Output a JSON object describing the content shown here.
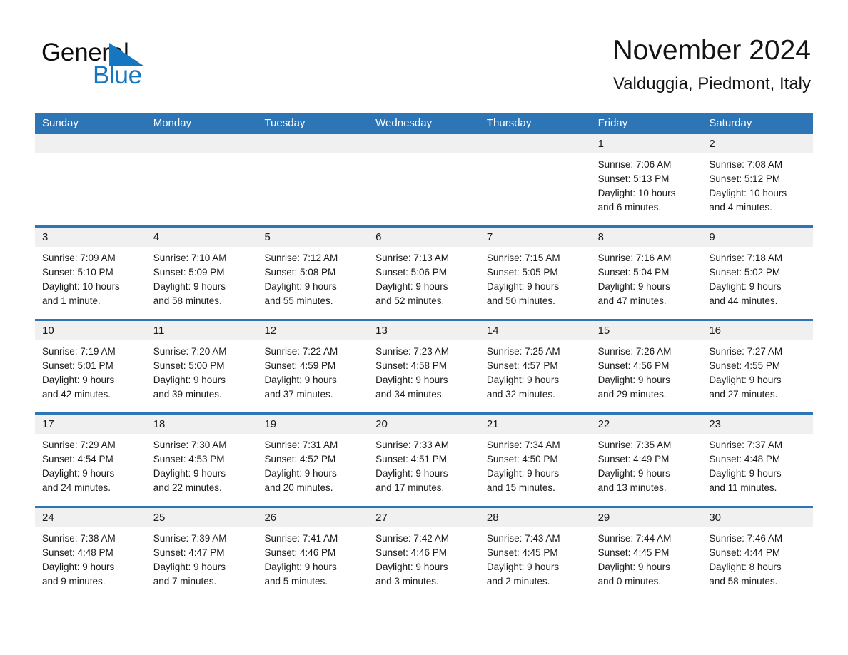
{
  "brand": {
    "line1": "General",
    "line2": "Blue",
    "triangle_color": "#1577c2",
    "icon": "triangle-logo-icon"
  },
  "header": {
    "title": "November 2024",
    "subtitle": "Valduggia, Piedmont, Italy"
  },
  "theme": {
    "header_blue": "#2e75b6",
    "day_band_gray": "#f0f0f0",
    "text": "#1a1a1a",
    "brand_blue": "#1577c2"
  },
  "weekdays": [
    "Sunday",
    "Monday",
    "Tuesday",
    "Wednesday",
    "Thursday",
    "Friday",
    "Saturday"
  ],
  "weeks": [
    [
      {
        "day": "",
        "lines": []
      },
      {
        "day": "",
        "lines": []
      },
      {
        "day": "",
        "lines": []
      },
      {
        "day": "",
        "lines": []
      },
      {
        "day": "",
        "lines": []
      },
      {
        "day": "1",
        "lines": [
          "Sunrise: 7:06 AM",
          "Sunset: 5:13 PM",
          "Daylight: 10 hours",
          "and 6 minutes."
        ]
      },
      {
        "day": "2",
        "lines": [
          "Sunrise: 7:08 AM",
          "Sunset: 5:12 PM",
          "Daylight: 10 hours",
          "and 4 minutes."
        ]
      }
    ],
    [
      {
        "day": "3",
        "lines": [
          "Sunrise: 7:09 AM",
          "Sunset: 5:10 PM",
          "Daylight: 10 hours",
          "and 1 minute."
        ]
      },
      {
        "day": "4",
        "lines": [
          "Sunrise: 7:10 AM",
          "Sunset: 5:09 PM",
          "Daylight: 9 hours",
          "and 58 minutes."
        ]
      },
      {
        "day": "5",
        "lines": [
          "Sunrise: 7:12 AM",
          "Sunset: 5:08 PM",
          "Daylight: 9 hours",
          "and 55 minutes."
        ]
      },
      {
        "day": "6",
        "lines": [
          "Sunrise: 7:13 AM",
          "Sunset: 5:06 PM",
          "Daylight: 9 hours",
          "and 52 minutes."
        ]
      },
      {
        "day": "7",
        "lines": [
          "Sunrise: 7:15 AM",
          "Sunset: 5:05 PM",
          "Daylight: 9 hours",
          "and 50 minutes."
        ]
      },
      {
        "day": "8",
        "lines": [
          "Sunrise: 7:16 AM",
          "Sunset: 5:04 PM",
          "Daylight: 9 hours",
          "and 47 minutes."
        ]
      },
      {
        "day": "9",
        "lines": [
          "Sunrise: 7:18 AM",
          "Sunset: 5:02 PM",
          "Daylight: 9 hours",
          "and 44 minutes."
        ]
      }
    ],
    [
      {
        "day": "10",
        "lines": [
          "Sunrise: 7:19 AM",
          "Sunset: 5:01 PM",
          "Daylight: 9 hours",
          "and 42 minutes."
        ]
      },
      {
        "day": "11",
        "lines": [
          "Sunrise: 7:20 AM",
          "Sunset: 5:00 PM",
          "Daylight: 9 hours",
          "and 39 minutes."
        ]
      },
      {
        "day": "12",
        "lines": [
          "Sunrise: 7:22 AM",
          "Sunset: 4:59 PM",
          "Daylight: 9 hours",
          "and 37 minutes."
        ]
      },
      {
        "day": "13",
        "lines": [
          "Sunrise: 7:23 AM",
          "Sunset: 4:58 PM",
          "Daylight: 9 hours",
          "and 34 minutes."
        ]
      },
      {
        "day": "14",
        "lines": [
          "Sunrise: 7:25 AM",
          "Sunset: 4:57 PM",
          "Daylight: 9 hours",
          "and 32 minutes."
        ]
      },
      {
        "day": "15",
        "lines": [
          "Sunrise: 7:26 AM",
          "Sunset: 4:56 PM",
          "Daylight: 9 hours",
          "and 29 minutes."
        ]
      },
      {
        "day": "16",
        "lines": [
          "Sunrise: 7:27 AM",
          "Sunset: 4:55 PM",
          "Daylight: 9 hours",
          "and 27 minutes."
        ]
      }
    ],
    [
      {
        "day": "17",
        "lines": [
          "Sunrise: 7:29 AM",
          "Sunset: 4:54 PM",
          "Daylight: 9 hours",
          "and 24 minutes."
        ]
      },
      {
        "day": "18",
        "lines": [
          "Sunrise: 7:30 AM",
          "Sunset: 4:53 PM",
          "Daylight: 9 hours",
          "and 22 minutes."
        ]
      },
      {
        "day": "19",
        "lines": [
          "Sunrise: 7:31 AM",
          "Sunset: 4:52 PM",
          "Daylight: 9 hours",
          "and 20 minutes."
        ]
      },
      {
        "day": "20",
        "lines": [
          "Sunrise: 7:33 AM",
          "Sunset: 4:51 PM",
          "Daylight: 9 hours",
          "and 17 minutes."
        ]
      },
      {
        "day": "21",
        "lines": [
          "Sunrise: 7:34 AM",
          "Sunset: 4:50 PM",
          "Daylight: 9 hours",
          "and 15 minutes."
        ]
      },
      {
        "day": "22",
        "lines": [
          "Sunrise: 7:35 AM",
          "Sunset: 4:49 PM",
          "Daylight: 9 hours",
          "and 13 minutes."
        ]
      },
      {
        "day": "23",
        "lines": [
          "Sunrise: 7:37 AM",
          "Sunset: 4:48 PM",
          "Daylight: 9 hours",
          "and 11 minutes."
        ]
      }
    ],
    [
      {
        "day": "24",
        "lines": [
          "Sunrise: 7:38 AM",
          "Sunset: 4:48 PM",
          "Daylight: 9 hours",
          "and 9 minutes."
        ]
      },
      {
        "day": "25",
        "lines": [
          "Sunrise: 7:39 AM",
          "Sunset: 4:47 PM",
          "Daylight: 9 hours",
          "and 7 minutes."
        ]
      },
      {
        "day": "26",
        "lines": [
          "Sunrise: 7:41 AM",
          "Sunset: 4:46 PM",
          "Daylight: 9 hours",
          "and 5 minutes."
        ]
      },
      {
        "day": "27",
        "lines": [
          "Sunrise: 7:42 AM",
          "Sunset: 4:46 PM",
          "Daylight: 9 hours",
          "and 3 minutes."
        ]
      },
      {
        "day": "28",
        "lines": [
          "Sunrise: 7:43 AM",
          "Sunset: 4:45 PM",
          "Daylight: 9 hours",
          "and 2 minutes."
        ]
      },
      {
        "day": "29",
        "lines": [
          "Sunrise: 7:44 AM",
          "Sunset: 4:45 PM",
          "Daylight: 9 hours",
          "and 0 minutes."
        ]
      },
      {
        "day": "30",
        "lines": [
          "Sunrise: 7:46 AM",
          "Sunset: 4:44 PM",
          "Daylight: 8 hours",
          "and 58 minutes."
        ]
      }
    ]
  ]
}
